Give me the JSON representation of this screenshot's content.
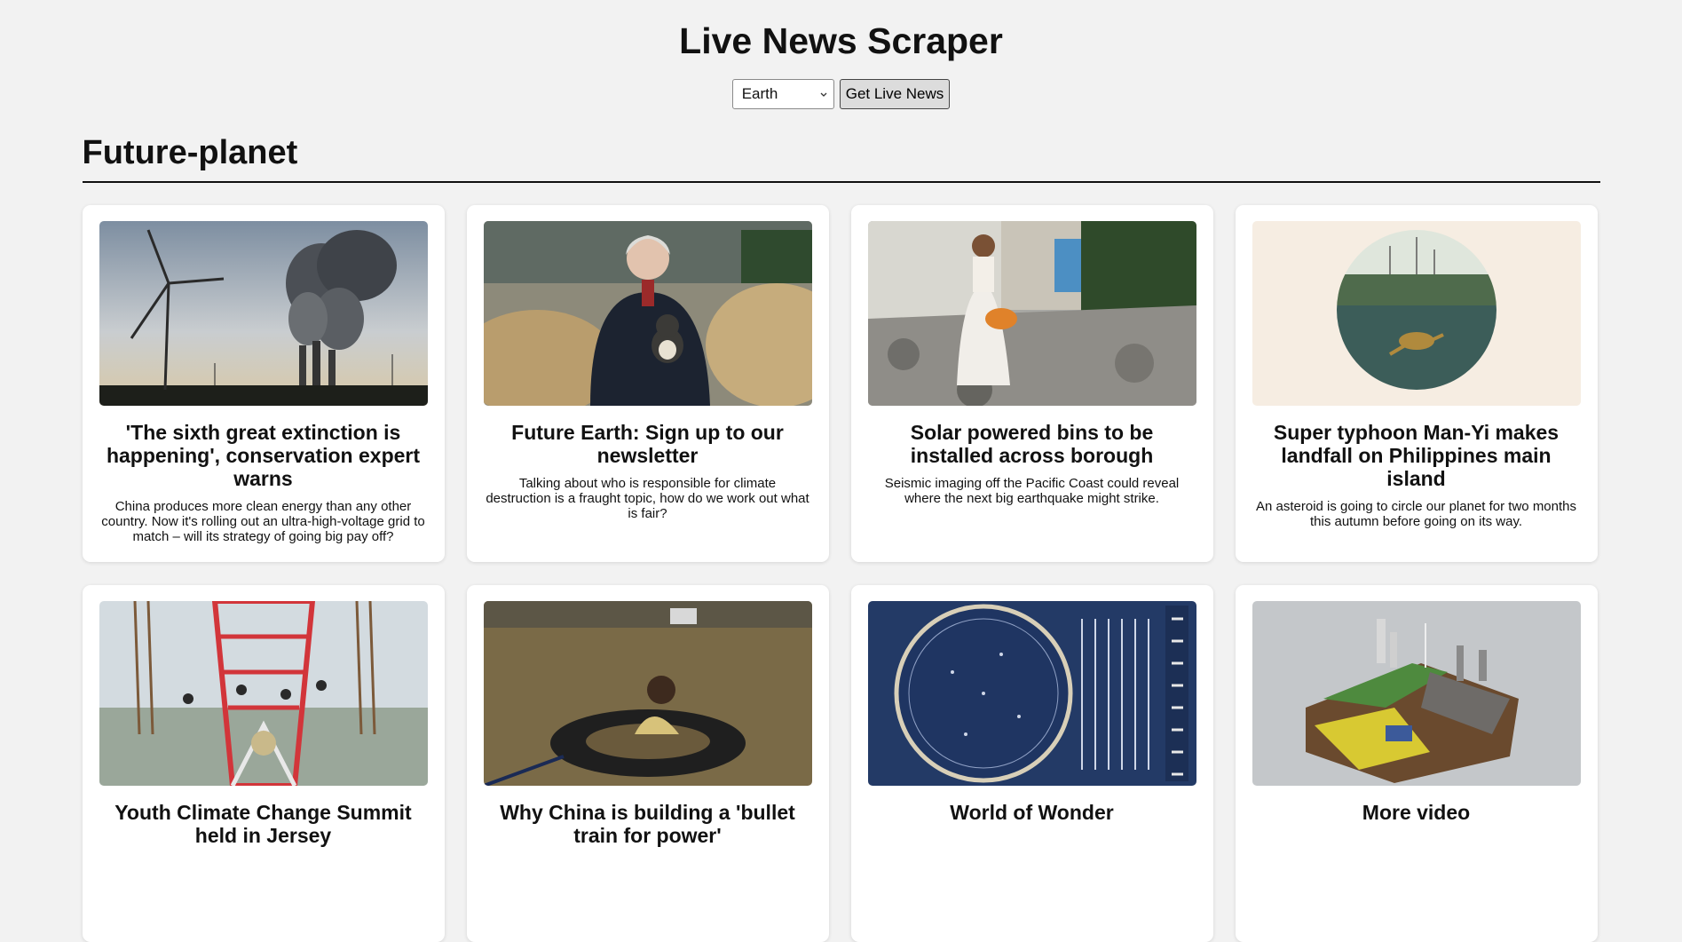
{
  "header": {
    "title": "Live News Scraper"
  },
  "controls": {
    "selected_category": "Earth",
    "fetch_label": "Get Live News"
  },
  "section": {
    "title": "Future-planet"
  },
  "articles": [
    {
      "title": "'The sixth great extinction is happening', conservation expert warns",
      "summary": "China produces more clean energy than any other country. Now it's rolling out an ultra-high-voltage grid to match – will its strategy of going big pay off?"
    },
    {
      "title": "Future Earth: Sign up to our newsletter",
      "summary": "Talking about who is responsible for climate destruction is a fraught topic, how do we work out what is fair?"
    },
    {
      "title": "Solar powered bins to be installed across borough",
      "summary": "Seismic imaging off the Pacific Coast could reveal where the next big earthquake might strike."
    },
    {
      "title": "Super typhoon Man-Yi makes landfall on Philippines main island",
      "summary": "An asteroid is going to circle our planet for two months this autumn before going on its way."
    },
    {
      "title": "Youth Climate Change Summit held in Jersey",
      "summary": ""
    },
    {
      "title": "Why China is building a 'bullet train for power'",
      "summary": ""
    },
    {
      "title": "World of Wonder",
      "summary": ""
    },
    {
      "title": "More video",
      "summary": ""
    }
  ]
}
